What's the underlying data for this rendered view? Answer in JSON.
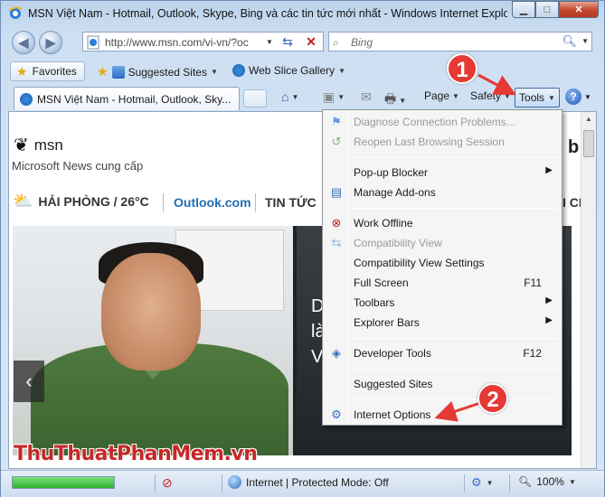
{
  "window": {
    "title": "MSN Việt Nam - Hotmail, Outlook, Skype, Bing và các tin tức mới nhất - Windows Internet Explorer",
    "controls": {
      "minimize": "▁",
      "maximize": "□",
      "close": "✕"
    }
  },
  "address_bar": {
    "url": "http://www.msn.com/vi-vn/?oc",
    "search_placeholder": "Bing"
  },
  "favorites_bar": {
    "favorites_label": "Favorites",
    "items": [
      {
        "label": "Suggested Sites"
      },
      {
        "label": "Web Slice Gallery"
      }
    ]
  },
  "tabs": [
    {
      "label": "MSN Việt Nam - Hotmail, Outlook, Sky..."
    }
  ],
  "command_bar": {
    "page_label": "Page",
    "safety_label": "Safety",
    "tools_label": "Tools",
    "help_label": "?"
  },
  "page": {
    "logo_text": "msn",
    "subtitle": "Microsoft News cung cấp",
    "weather": "HẢI PHÒNG / 26°C",
    "nav_links": [
      "Outlook.com",
      "TIN TỨC",
      "I CH"
    ],
    "hero_text_lines": [
      "D",
      "là",
      "V"
    ],
    "hero_prev": "‹",
    "bing_mark": "b"
  },
  "tools_menu": {
    "items": [
      {
        "label": "Diagnose Connection Problems...",
        "disabled": true,
        "icon": "diagnose-icon"
      },
      {
        "label": "Reopen Last Browsing Session",
        "disabled": true,
        "icon": "reopen-icon"
      },
      {
        "label": "Pop-up Blocker",
        "submenu": true,
        "icon": ""
      },
      {
        "label": "Manage Add-ons",
        "icon": "addons-icon"
      },
      {
        "label": "Work Offline",
        "icon": "offline-icon"
      },
      {
        "label": "Compatibility View",
        "disabled": true,
        "icon": "compat-icon"
      },
      {
        "label": "Compatibility View Settings",
        "icon": ""
      },
      {
        "label": "Full Screen",
        "shortcut": "F11",
        "icon": ""
      },
      {
        "label": "Toolbars",
        "submenu": true,
        "icon": ""
      },
      {
        "label": "Explorer Bars",
        "submenu": true,
        "icon": ""
      },
      {
        "label": "Developer Tools",
        "shortcut": "F12",
        "icon": "devtools-icon"
      },
      {
        "label": "Suggested Sites",
        "icon": ""
      },
      {
        "label": "Internet Options",
        "icon": "internet-options-icon"
      }
    ]
  },
  "status_bar": {
    "progress": 1.0,
    "zone": "Internet | Protected Mode: Off",
    "zoom": "100%"
  },
  "annotations": {
    "marker1": "1",
    "marker2": "2"
  },
  "watermark": "ThuThuatPhanMem.vn",
  "colors": {
    "marker": "#e53935",
    "accent": "#1f6fb2",
    "watermark": "#c62828"
  }
}
